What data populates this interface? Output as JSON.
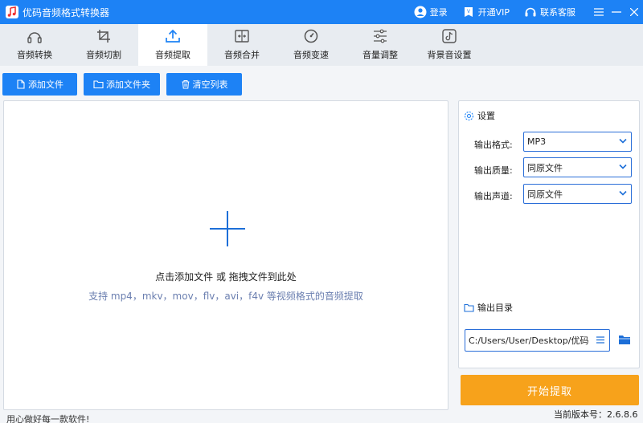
{
  "app": {
    "title": "优码音频格式转换器",
    "accent_color": "#1d82f5",
    "start_color": "#f7a21b",
    "logo_icon": "music-note-icon"
  },
  "titlebar": {
    "login_label": "登录",
    "vip_label": "开通VIP",
    "support_label": "联系客服"
  },
  "tabs": [
    {
      "label": "音频转换",
      "icon": "headphones-icon"
    },
    {
      "label": "音频切割",
      "icon": "crop-icon"
    },
    {
      "label": "音频提取",
      "icon": "upload-icon",
      "active": true
    },
    {
      "label": "音频合并",
      "icon": "merge-icon"
    },
    {
      "label": "音频变速",
      "icon": "speed-icon"
    },
    {
      "label": "音量调整",
      "icon": "sliders-icon"
    },
    {
      "label": "背景音设置",
      "icon": "tiktok-icon"
    }
  ],
  "actions": {
    "add_file": "添加文件",
    "add_folder": "添加文件夹",
    "clear_list": "清空列表"
  },
  "dropzone": {
    "main_text": "点击添加文件 或 拖拽文件到此处",
    "sub_text": "支持 mp4，mkv，mov，flv，avi，f4v 等视频格式的音频提取"
  },
  "settings": {
    "title": "设置",
    "format_label": "输出格式:",
    "format_value": "MP3",
    "quality_label": "输出质量:",
    "quality_value": "同原文件",
    "channel_label": "输出声道:",
    "channel_value": "同原文件",
    "output_title": "输出目录",
    "output_path": "C:/Users/User/Desktop/优码"
  },
  "start_label": "开始提取",
  "footer": {
    "slogan": "用心做好每一款软件!",
    "version": "当前版本号：2.6.8.6"
  }
}
